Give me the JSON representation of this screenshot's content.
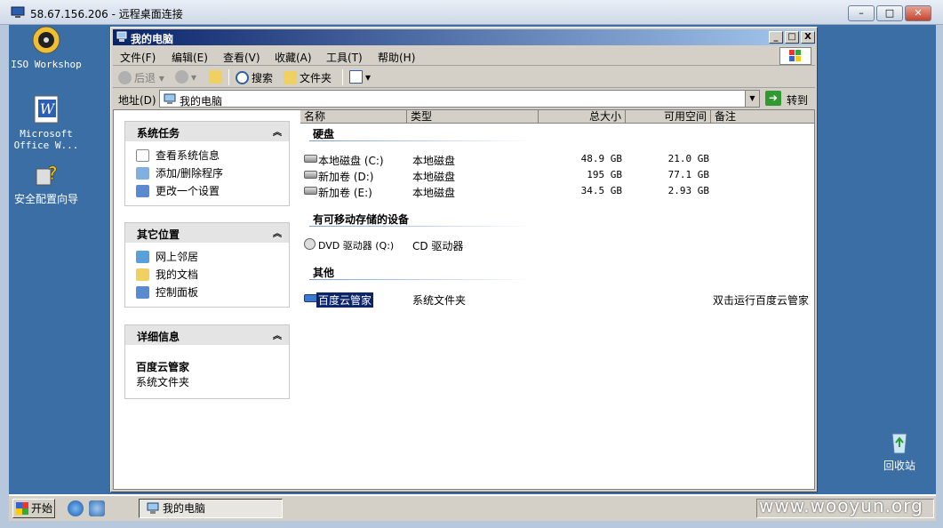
{
  "rdp": {
    "title": "58.67.156.206 - 远程桌面连接",
    "controls": [
      "–",
      "□",
      "✕"
    ]
  },
  "desktop": {
    "icons": [
      {
        "label": "ISO Workshop",
        "icon": "iso-workshop-icon"
      },
      {
        "label": "Microsoft Office W...",
        "icon": "word-icon"
      },
      {
        "label": "安全配置向导",
        "icon": "security-wizard-icon"
      },
      {
        "label": "回收站",
        "icon": "recycle-bin-icon"
      }
    ]
  },
  "window": {
    "title": "我的电脑",
    "controls": [
      "_",
      "□",
      "X"
    ]
  },
  "menu": [
    "文件(F)",
    "编辑(E)",
    "查看(V)",
    "收藏(A)",
    "工具(T)",
    "帮助(H)"
  ],
  "toolbar": {
    "back": "后退",
    "search": "搜索",
    "folders": "文件夹"
  },
  "address": {
    "label": "地址(D)",
    "value": "我的电脑",
    "go": "转到"
  },
  "tasks": {
    "system": {
      "title": "系统任务",
      "items": [
        "查看系统信息",
        "添加/删除程序",
        "更改一个设置"
      ]
    },
    "other": {
      "title": "其它位置",
      "items": [
        "网上邻居",
        "我的文档",
        "控制面板"
      ]
    },
    "details": {
      "title": "详细信息",
      "name": "百度云管家",
      "type": "系统文件夹"
    }
  },
  "columns": [
    "名称",
    "类型",
    "总大小",
    "可用空间",
    "备注"
  ],
  "groups": {
    "hdd": "硬盘",
    "removable": "有可移动存储的设备",
    "other": "其他"
  },
  "drives": [
    {
      "name": "本地磁盘 (C:)",
      "type": "本地磁盘",
      "total": "48.9 GB",
      "free": "21.0 GB"
    },
    {
      "name": "新加卷 (D:)",
      "type": "本地磁盘",
      "total": "195 GB",
      "free": "77.1 GB"
    },
    {
      "name": "新加卷 (E:)",
      "type": "本地磁盘",
      "total": "34.5 GB",
      "free": "2.93 GB"
    }
  ],
  "removable": [
    {
      "name": "DVD 驱动器 (Q:)",
      "type": "CD 驱动器"
    }
  ],
  "others": [
    {
      "name": "百度云管家",
      "type": "系统文件夹",
      "comment": "双击运行百度云管家"
    }
  ],
  "taskbar": {
    "start": "开始",
    "task": "我的电脑"
  },
  "watermark": "www.wooyun.org"
}
